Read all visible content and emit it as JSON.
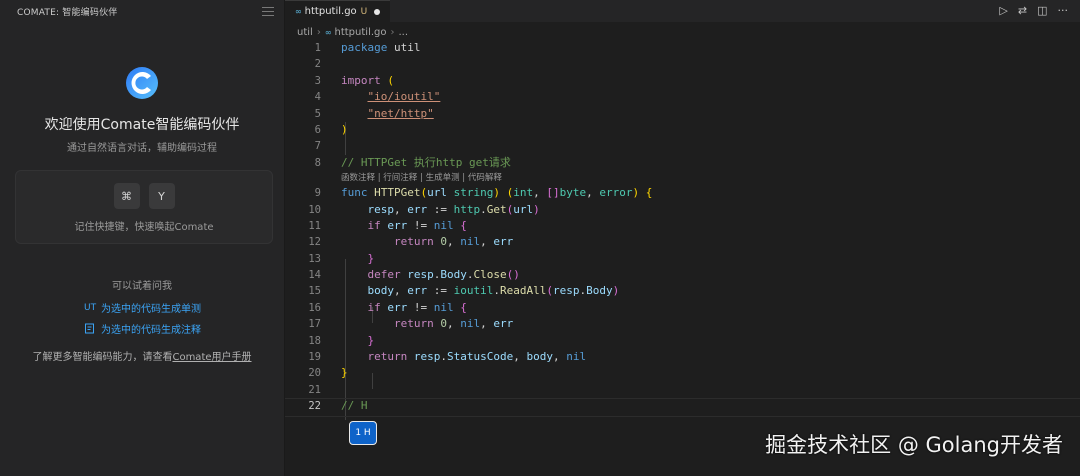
{
  "sidebar": {
    "title": "COMATE: 智能编码伙伴",
    "welcome_title": "欢迎使用Comate智能编码伙伴",
    "welcome_subtitle": "通过自然语言对话，辅助编码过程",
    "shortcut_keys": [
      "⌘",
      "Y"
    ],
    "shortcut_hint": "记住快捷键，快速唤起Comate",
    "try_title": "可以试着问我",
    "try_items": [
      {
        "icon": "UT",
        "label": "为选中的代码生成单测"
      },
      {
        "icon": "note-icon",
        "label": "为选中的代码生成注释"
      }
    ],
    "more_prefix": "了解更多智能编码能力，请查看",
    "more_link": "Comate用户手册",
    "accent_color": "#3ba4f5"
  },
  "editor": {
    "tab": {
      "label": "httputil.go",
      "status": "U"
    },
    "breadcrumb": [
      "util",
      "httputil.go",
      "..."
    ],
    "codelens": [
      "函数注释",
      "行间注释",
      "生成单测",
      "代码解释"
    ],
    "code_lines": [
      {
        "n": "1",
        "text": "package util"
      },
      {
        "n": "2",
        "text": ""
      },
      {
        "n": "3",
        "text": "import ("
      },
      {
        "n": "4",
        "text": "    \"io/ioutil\""
      },
      {
        "n": "5",
        "text": "    \"net/http\""
      },
      {
        "n": "6",
        "text": ")"
      },
      {
        "n": "7",
        "text": ""
      },
      {
        "n": "8",
        "text": "// HTTPGet 执行http get请求"
      },
      {
        "n": "9",
        "text": "func HTTPGet(url string) (int, []byte, error) {"
      },
      {
        "n": "10",
        "text": "    resp, err := http.Get(url)"
      },
      {
        "n": "11",
        "text": "    if err != nil {"
      },
      {
        "n": "12",
        "text": "        return 0, nil, err"
      },
      {
        "n": "13",
        "text": "    }"
      },
      {
        "n": "14",
        "text": "    defer resp.Body.Close()"
      },
      {
        "n": "15",
        "text": "    body, err := ioutil.ReadAll(resp.Body)"
      },
      {
        "n": "16",
        "text": "    if err != nil {"
      },
      {
        "n": "17",
        "text": "        return 0, nil, err"
      },
      {
        "n": "18",
        "text": "    }"
      },
      {
        "n": "19",
        "text": "    return resp.StatusCode, body, nil"
      },
      {
        "n": "20",
        "text": "}"
      },
      {
        "n": "21",
        "text": ""
      },
      {
        "n": "22",
        "text": "// H"
      }
    ],
    "suggestion_badge": "1 H"
  },
  "watermark": "掘金技术社区 @ Golang开发者"
}
